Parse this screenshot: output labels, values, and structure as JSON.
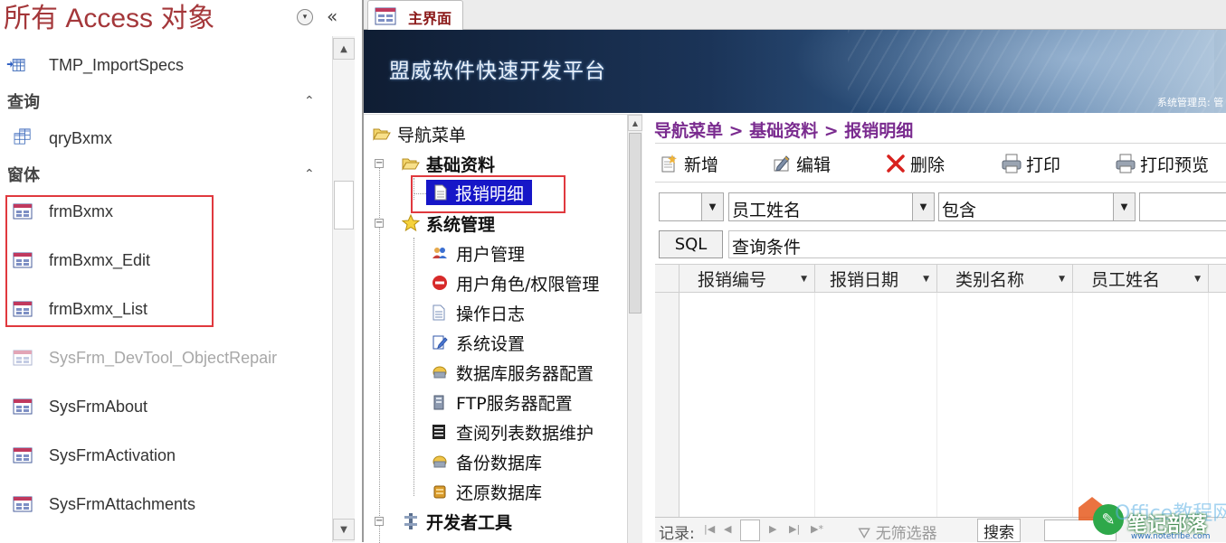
{
  "nav": {
    "title": "所有 Access 对象",
    "collapse_glyph": "«",
    "menu_glyph": "▾",
    "items": [
      {
        "kind": "object",
        "type": "table",
        "label": "TMP_ImportSpecs"
      },
      {
        "kind": "group",
        "label": "查询",
        "chevron": "⌃"
      },
      {
        "kind": "object",
        "type": "query",
        "label": "qryBxmx"
      },
      {
        "kind": "group",
        "label": "窗体",
        "chevron": "⌃"
      },
      {
        "kind": "object",
        "type": "form",
        "label": "frmBxmx"
      },
      {
        "kind": "object",
        "type": "form",
        "label": "frmBxmx_Edit"
      },
      {
        "kind": "object",
        "type": "form",
        "label": "frmBxmx_List"
      },
      {
        "kind": "object",
        "type": "form",
        "label": "SysFrm_DevTool_ObjectRepair",
        "dim": true
      },
      {
        "kind": "object",
        "type": "form",
        "label": "SysFrmAbout"
      },
      {
        "kind": "object",
        "type": "form",
        "label": "SysFrmActivation"
      },
      {
        "kind": "object",
        "type": "form",
        "label": "SysFrmAttachments"
      }
    ]
  },
  "document_tab": {
    "label": "主界面"
  },
  "banner": {
    "title": "盟威软件快速开发平台",
    "user_text": "系统管理员: 管"
  },
  "tree": {
    "root": "导航菜单",
    "nodes": [
      {
        "label": "基础资料",
        "level": 1,
        "bold": true,
        "icon": "folder-open-icon",
        "expander": "−"
      },
      {
        "label": "报销明细",
        "level": 2,
        "selected": true,
        "icon": "document-icon"
      },
      {
        "label": "系统管理",
        "level": 1,
        "bold": true,
        "icon": "star-icon",
        "expander": "−"
      },
      {
        "label": "用户管理",
        "level": 2,
        "icon": "users-icon"
      },
      {
        "label": "用户角色/权限管理",
        "level": 2,
        "icon": "no-entry-icon"
      },
      {
        "label": "操作日志",
        "level": 2,
        "icon": "log-icon"
      },
      {
        "label": "系统设置",
        "level": 2,
        "icon": "settings-edit-icon"
      },
      {
        "label": "数据库服务器配置",
        "level": 2,
        "icon": "db-server-icon"
      },
      {
        "label": "FTP服务器配置",
        "level": 2,
        "icon": "ftp-server-icon"
      },
      {
        "label": "查阅列表数据维护",
        "level": 2,
        "icon": "list-icon"
      },
      {
        "label": "备份数据库",
        "level": 2,
        "icon": "backup-icon"
      },
      {
        "label": "还原数据库",
        "level": 2,
        "icon": "restore-icon"
      },
      {
        "label": "开发者工具",
        "level": 1,
        "bold": true,
        "icon": "tools-icon",
        "expander": "−"
      }
    ]
  },
  "breadcrumb": "导航菜单 > 基础资料 > 报销明细",
  "toolbar": {
    "new_label": "新增",
    "edit_label": "编辑",
    "delete_label": "删除",
    "print_label": "打印",
    "preview_label": "打印预览"
  },
  "filter": {
    "field_value": "员工姓名",
    "operator_value": "包含",
    "first_value": "",
    "criteria_value": ""
  },
  "sql": {
    "button_label": "SQL",
    "condition_text": "查询条件"
  },
  "grid": {
    "columns": [
      "报销编号",
      "报销日期",
      "类别名称",
      "员工姓名"
    ],
    "rows": []
  },
  "record_bar": {
    "label": "记录:",
    "filter_label": "无筛选器",
    "search_label": "搜索"
  },
  "watermark": {
    "line1": "Office教程网",
    "line2": "笔记部落",
    "url": "www.notetribe.com"
  }
}
